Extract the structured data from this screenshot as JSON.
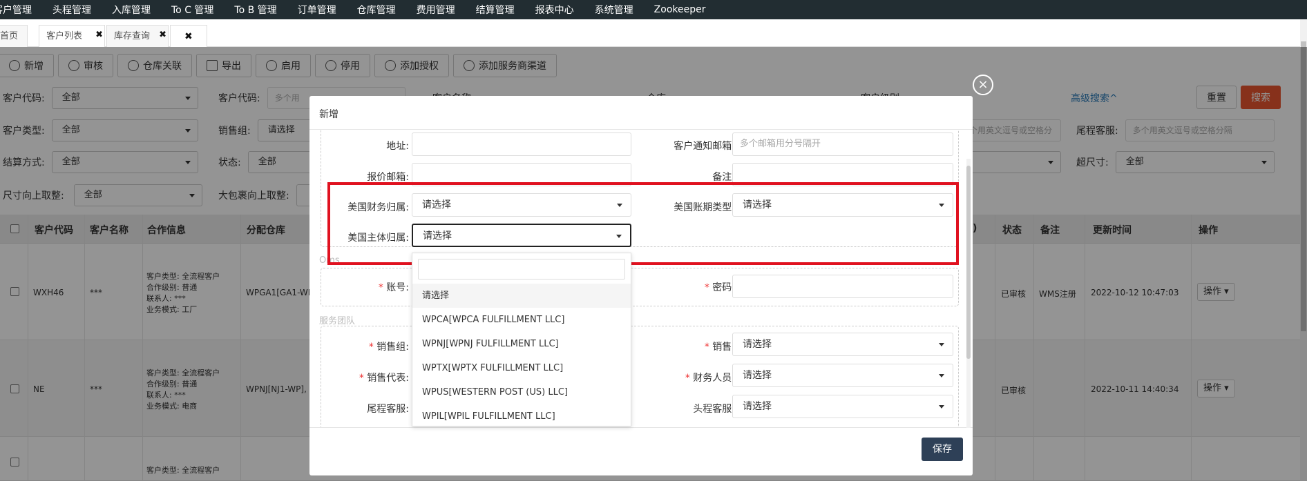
{
  "topnav": [
    "客户管理",
    "头程管理",
    "入库管理",
    "To C 管理",
    "To B 管理",
    "订单管理",
    "仓库管理",
    "费用管理",
    "结算管理",
    "报表中心",
    "系统管理",
    "Zookeeper"
  ],
  "tabs": [
    {
      "label": "首页"
    },
    {
      "label": "客户列表",
      "close": "✖"
    },
    {
      "label": "库存查询",
      "close": "✖"
    },
    {
      "label": "",
      "close": "✖"
    }
  ],
  "toolbar": [
    {
      "label": "新增",
      "icon": "plus-circle-icon"
    },
    {
      "label": "审核",
      "icon": "user-icon"
    },
    {
      "label": "仓库关联",
      "icon": "user-icon"
    },
    {
      "label": "导出",
      "icon": "export-icon"
    },
    {
      "label": "启用",
      "icon": "user-icon"
    },
    {
      "label": "停用",
      "icon": "ban-icon"
    },
    {
      "label": "添加授权",
      "icon": "user-icon"
    },
    {
      "label": "添加服务商渠道",
      "icon": "user-icon"
    }
  ],
  "filters": {
    "customer_code_label": "客户代码:",
    "customer_code_value": "全部",
    "customer_code2_label": "客户代码:",
    "customer_code2_placeholder": "多个用",
    "customer_name_label": "客户名称",
    "warehouse_label": "仓库",
    "customer_level_label": "客户级别",
    "advanced_search": "高级搜索^",
    "reset": "重置",
    "search": "搜索",
    "customer_type_label": "客户类型:",
    "customer_type_value": "全部",
    "sales_group_label": "销售组:",
    "sales_group_value": "请选择",
    "multi_placeholder": "多个用英文逗号或空格分隔",
    "tail_service_label": "尾程客服:",
    "tail_service_placeholder": "多个用英文逗号或空格分隔",
    "settle_label": "结算方式:",
    "settle_value": "全部",
    "status_label": "状态:",
    "status_value": "全部",
    "oversize_label": "超尺寸:",
    "oversize_value": "全部",
    "round_up_label": "尺寸向上取整:",
    "round_up_value": "全部",
    "big_round_label": "大包裹向上取整:"
  },
  "table": {
    "headers": [
      "客户代码",
      "客户名称",
      "合作信息",
      "分配仓库",
      ")",
      "状态",
      "备注",
      "更新时间",
      "操作"
    ],
    "rows": [
      {
        "code": "WXH46",
        "name": "***",
        "info": [
          "客户类型: 全流程客户",
          "合作级别: 普通",
          "联系人: ***",
          "业务模式: 工厂"
        ],
        "warehouse": "WPGA1[GA1-WI",
        "status": "已审核",
        "remark": "WMS注册",
        "updated": "2022-10-12 10:47:03",
        "op": "操作"
      },
      {
        "code": "NE",
        "name": "***",
        "info": [
          "客户类型: 全流程客户",
          "合作级别: 普通",
          "联系人: ***",
          "业务模式: 电商"
        ],
        "warehouse": "WPNJ[NJ1-WP],",
        "status": "已审核",
        "remark": "",
        "updated": "2022-10-11 14:40:34",
        "op": "操作"
      },
      {
        "code": "",
        "name": "",
        "info": [
          "客户类型: 全流程客户"
        ],
        "warehouse": "",
        "status": "",
        "remark": "",
        "updated": "",
        "op": ""
      }
    ]
  },
  "modal": {
    "title": "新增",
    "close": "×",
    "address_label": "地址:",
    "notify_email_label": "客户通知邮箱:",
    "notify_email_placeholder": "多个邮箱用分号隔开",
    "quote_email_label": "报价邮箱:",
    "remark_label": "备注:",
    "us_finance_label": "美国财务归属:",
    "us_finance_value": "请选择",
    "us_period_label": "美国账期类型:",
    "us_period_value": "请选择",
    "us_entity_label": "美国主体归属:",
    "us_entity_value": "请选择",
    "oms_section": "Oms",
    "account_label": "账号:",
    "password_label": "密码:",
    "service_section": "服务团队",
    "sales_group_label": "销售组:",
    "sales_label": "销售:",
    "sales_value": "请选择",
    "sales_rep_label": "销售代表:",
    "finance_label": "财务人员:",
    "finance_value": "请选择",
    "tail_label": "尾程客服:",
    "head_label": "头程客服:",
    "head_value": "请选择",
    "save": "保存",
    "required_mark": "*"
  },
  "dropdown": {
    "options": [
      "请选择",
      "WPCA[WPCA FULFILLMENT LLC]",
      "WPNJ[WPNJ FULFILLMENT LLC]",
      "WPTX[WPTX FULFILLMENT LLC]",
      "WPUS[WESTERN POST (US) LLC]",
      "WPIL[WPIL FULFILLMENT LLC]"
    ]
  },
  "colors": {
    "nav_bg": "#222d32",
    "search_btn": "#e8552f",
    "save_btn": "#2e4057",
    "highlight": "#e0111f",
    "link": "#2a7ab8"
  }
}
